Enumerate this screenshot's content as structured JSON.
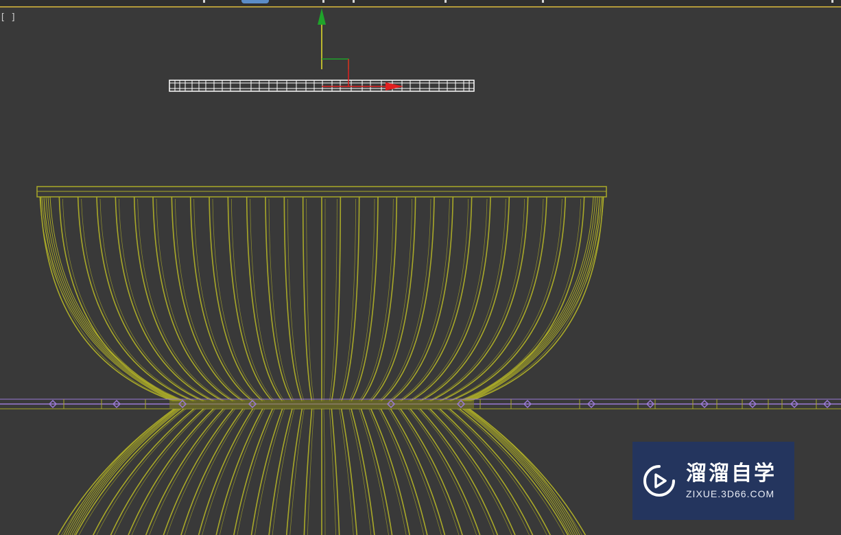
{
  "viewport": {
    "label": "[ ]",
    "background_color": "#393939"
  },
  "toolbar_strip": {
    "accent_color": "#b39a3a",
    "active_tab_color": "#5b8cc7"
  },
  "scene": {
    "wireframe_color": "#a9a928",
    "selected_object_color": "#ffffff",
    "spline_color": "#9b7ad6",
    "gizmo": {
      "y_axis_color": "#1fa32a",
      "x_axis_color": "#e02020",
      "z_axis_color": "#e8e22a"
    }
  },
  "watermark": {
    "title": "溜溜自学",
    "url": "ZIXUE.3D66.COM",
    "logo_icon": "play-circle-icon",
    "background_color": "#24355e"
  }
}
